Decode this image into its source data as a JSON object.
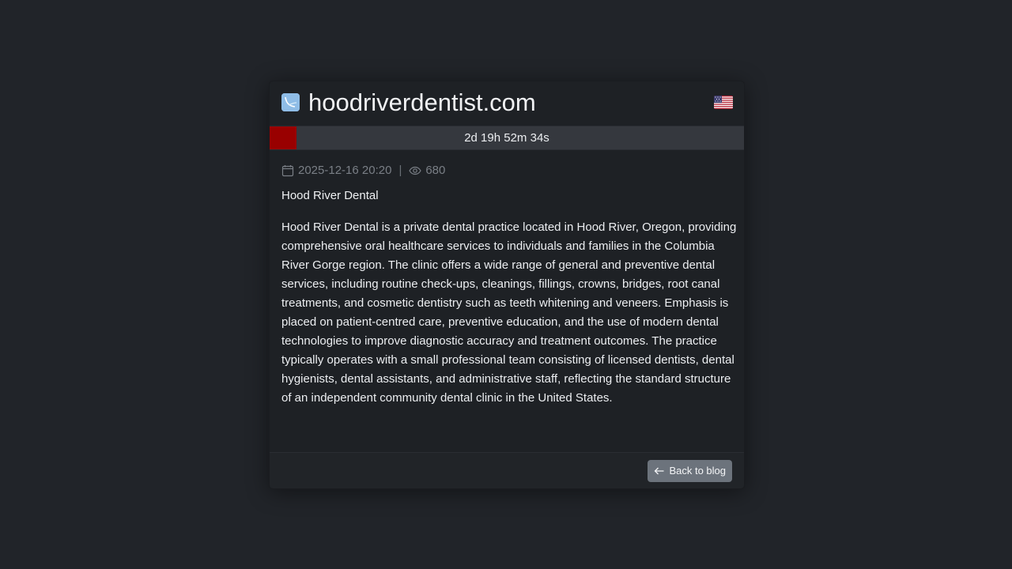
{
  "header": {
    "domain": "hoodriverdentist.com",
    "favicon_icon": "dental-clinic-favicon-icon",
    "flag_icon": "us-flag-icon"
  },
  "countdown": {
    "text": "2d 19h 52m 34s",
    "progress_fraction": 0.056,
    "fill_color": "#990000"
  },
  "meta": {
    "date": "2025-12-16 20:20",
    "separator": "|",
    "views": "680",
    "date_icon": "calendar-icon",
    "views_icon": "eye-icon"
  },
  "post": {
    "title": "Hood River Dental",
    "body": "Hood River Dental is a private dental practice located in Hood River, Oregon, providing comprehensive oral healthcare services to individuals and families in the Columbia River Gorge region. The clinic offers a wide range of general and preventive dental services, including routine check-ups, cleanings, fillings, crowns, bridges, root canal treatments, and cosmetic dentistry such as teeth whitening and veneers. Emphasis is placed on patient-centred care, preventive education, and the use of modern dental technologies to improve diagnostic accuracy and treatment outcomes. The practice typically operates with a small professional team consisting of licensed dentists, dental hygienists, dental assistants, and administrative staff, reflecting the standard structure of an independent community dental clinic in the United States."
  },
  "footer": {
    "back_label": "Back to blog",
    "back_icon": "arrow-left-icon"
  },
  "colors": {
    "background": "#212429",
    "card": "#1e2125",
    "button": "#6c737c"
  }
}
